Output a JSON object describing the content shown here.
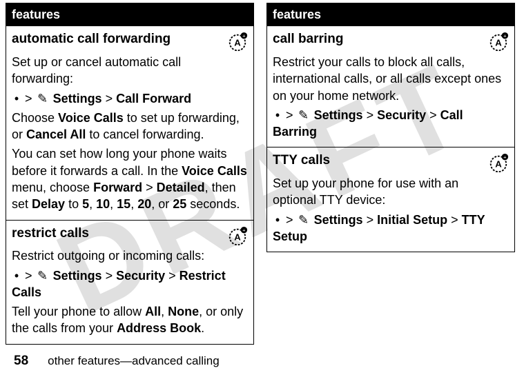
{
  "watermark": "DRAFT",
  "left": {
    "header": "features",
    "rows": [
      {
        "title": "automatic call forwarding",
        "body1a": "Set up or cancel automatic call forwarding:",
        "path1_settings": "Settings",
        "path1_sep": " > ",
        "path1_end": "Call Forward",
        "body2_pre": "Choose ",
        "body2_b1": "Voice Calls",
        "body2_mid": " to set up forwarding, or ",
        "body2_b2": "Cancel All",
        "body2_post": " to cancel forwarding.",
        "body3_pre": "You can set how long your phone waits before it forwards a call. In the ",
        "body3_b1": "Voice Calls",
        "body3_mid1": " menu, choose ",
        "body3_b2": "Forward",
        "body3_gt1": " > ",
        "body3_b3": "Detailed",
        "body3_mid2": ", then set ",
        "body3_b4": "Delay",
        "body3_mid3": " to ",
        "body3_n1": "5",
        "body3_c1": ", ",
        "body3_n2": "10",
        "body3_c2": ", ",
        "body3_n3": "15",
        "body3_c3": ", ",
        "body3_n4": "20",
        "body3_c4": ", or ",
        "body3_n5": "25",
        "body3_post": " seconds."
      },
      {
        "title": "restrict calls",
        "body1": "Restrict outgoing or incoming calls:",
        "path_settings": "Settings",
        "path_sep1": " > ",
        "path_sec": "Security",
        "path_sep2": " > ",
        "path_end": "Restrict Calls",
        "body2_pre": "Tell your phone to allow ",
        "body2_b1": "All",
        "body2_c1": ", ",
        "body2_b2": "None",
        "body2_mid": ", or only the calls from your ",
        "body2_b3": "Address Book",
        "body2_post": "."
      }
    ]
  },
  "right": {
    "header": "features",
    "rows": [
      {
        "title": "call barring",
        "body1": "Restrict your calls to block all calls, international calls, or all calls except ones on your home network.",
        "path_settings": "Settings",
        "path_sep1": " > ",
        "path_sec": "Security",
        "path_sep2": " > ",
        "path_end": "Call Barring"
      },
      {
        "title": "TTY calls",
        "body1": "Set up your phone for use with an optional TTY device:",
        "path_settings": "Settings",
        "path_sep1": " > ",
        "path_mid": "Initial Setup",
        "path_sep2": " > ",
        "path_end": "TTY Setup"
      }
    ]
  },
  "footer": {
    "page": "58",
    "text": "other features—advanced calling"
  },
  "glyphs": {
    "lead": "•",
    "gt": ">",
    "book": "✎"
  }
}
